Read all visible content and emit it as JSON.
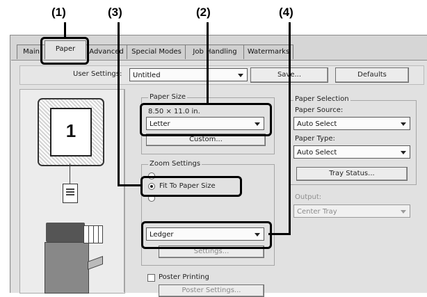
{
  "callouts": [
    "(1)",
    "(3)",
    "(2)",
    "(4)"
  ],
  "tabs": [
    "Main",
    "Paper",
    "Advanced",
    "Special Modes",
    "Job Handling",
    "Watermarks"
  ],
  "user_settings": {
    "label": "User Settings:",
    "value": "Untitled",
    "save_button": "Save...",
    "defaults_button": "Defaults"
  },
  "paper_size": {
    "label": "Paper Size",
    "dimensions": "8.50 × 11.0 in.",
    "value": "Letter",
    "custom_button": "Custom..."
  },
  "zoom_settings": {
    "label": "Zoom Settings",
    "option_fit": "Fit To Paper Size",
    "fit_size_value": "Ledger",
    "settings_button": "Settings..."
  },
  "poster": {
    "label": "Poster Printing",
    "settings_button": "Poster Settings..."
  },
  "paper_selection": {
    "label": "Paper Selection",
    "source_label": "Paper Source:",
    "source_value": "Auto Select",
    "type_label": "Paper Type:",
    "type_value": "Auto Select",
    "tray_status_button": "Tray Status..."
  },
  "output": {
    "label": "Output:",
    "value": "Center Tray"
  },
  "preview": {
    "page_number": "1"
  },
  "colors": {
    "highlight": "#000000",
    "panel": "#e1e1e1"
  }
}
